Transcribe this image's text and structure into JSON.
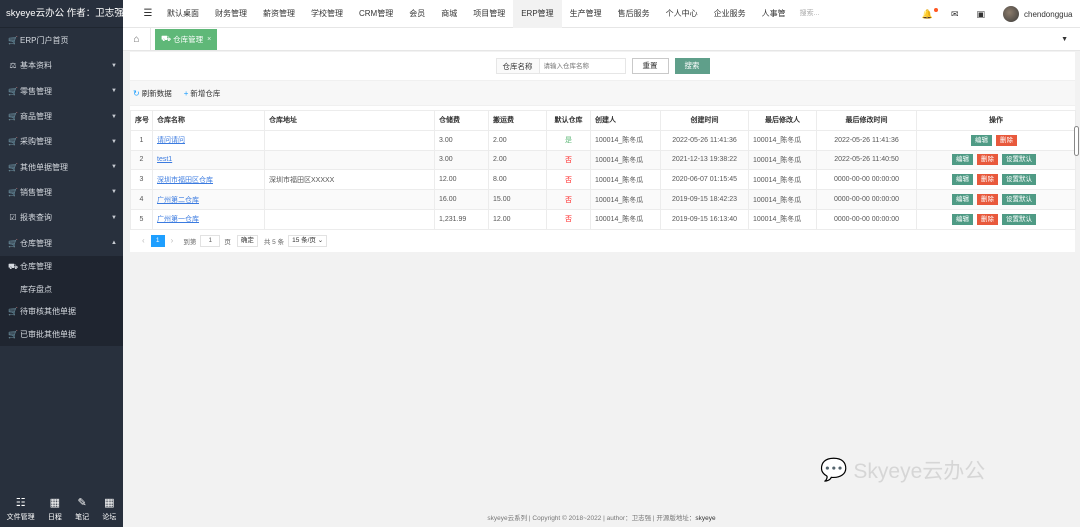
{
  "brand": "skyeye云办公 作者：卫志强",
  "sidebar": {
    "items": [
      {
        "icon": "cart-icon",
        "glyph": "🛒",
        "label": "ERP门户首页",
        "caret": ""
      },
      {
        "icon": "balance-icon",
        "glyph": "⚖",
        "label": "基本资料",
        "caret": "▼"
      },
      {
        "icon": "cart-icon",
        "glyph": "🛒",
        "label": "零售管理",
        "caret": "▼"
      },
      {
        "icon": "cart-icon",
        "glyph": "🛒",
        "label": "商品管理",
        "caret": "▼"
      },
      {
        "icon": "cart-icon",
        "glyph": "🛒",
        "label": "采购管理",
        "caret": "▼"
      },
      {
        "icon": "cart-icon",
        "glyph": "🛒",
        "label": "其他单据管理",
        "caret": "▼"
      },
      {
        "icon": "cart-icon",
        "glyph": "🛒",
        "label": "销售管理",
        "caret": "▼"
      },
      {
        "icon": "checkbox-icon",
        "glyph": "☑",
        "label": "报表查询",
        "caret": "▼"
      },
      {
        "icon": "cart-icon",
        "glyph": "🛒",
        "label": "仓库管理",
        "caret": "▲"
      }
    ],
    "subitems": [
      {
        "icon": "truck-icon",
        "glyph": "⛟",
        "label": "仓库管理"
      },
      {
        "icon": "cart-icon",
        "glyph": "",
        "label": "库存盘点"
      },
      {
        "icon": "cart-icon",
        "glyph": "🛒",
        "label": "待审核其他单据"
      },
      {
        "icon": "cart-icon",
        "glyph": "🛒",
        "label": "已审批其他单据"
      }
    ],
    "footer": [
      {
        "icon": "list-icon",
        "glyph": "☷",
        "label": "文件管理"
      },
      {
        "icon": "calendar-icon",
        "glyph": "▦",
        "label": "日程"
      },
      {
        "icon": "edit-icon",
        "glyph": "✎",
        "label": "笔记"
      },
      {
        "icon": "forum-icon",
        "glyph": "▦",
        "label": "论坛"
      }
    ]
  },
  "topnav": {
    "menu_glyph": "☰",
    "items": [
      "默认桌面",
      "财务管理",
      "薪资管理",
      "学校管理",
      "CRM管理",
      "会员",
      "商城",
      "项目管理",
      "ERP管理",
      "生产管理",
      "售后服务",
      "个人中心",
      "企业服务",
      "人事管"
    ],
    "active_index": 8,
    "search_placeholder": "搜索...",
    "username": "chendonggua"
  },
  "tabs": {
    "home_glyph": "⌂",
    "active_label": "仓库管理",
    "close_glyph": "×",
    "more_glyph": "▼"
  },
  "search": {
    "label": "仓库名称",
    "placeholder": "请输入仓库名称",
    "reset_label": "重置",
    "search_label": "搜索"
  },
  "toolbar": {
    "refresh_label": "刷新数据",
    "add_label": "新增仓库"
  },
  "table": {
    "headers": [
      "序号",
      "仓库名称",
      "仓库地址",
      "仓储费",
      "搬运费",
      "默认仓库",
      "创建人",
      "创建时间",
      "最后修改人",
      "最后修改时间",
      "操作"
    ],
    "rows": [
      {
        "no": "1",
        "name": "请问请问",
        "address": "",
        "storage_fee": "3.00",
        "handling_fee": "2.00",
        "default": "是",
        "is_default": true,
        "creator": "100014_陈冬瓜",
        "created": "2022-05-26 11:41:36",
        "modifier": "100014_陈冬瓜",
        "modified": "2022-05-26 11:41:36"
      },
      {
        "no": "2",
        "name": "test1",
        "address": "",
        "storage_fee": "3.00",
        "handling_fee": "2.00",
        "default": "否",
        "is_default": false,
        "creator": "100014_陈冬瓜",
        "created": "2021-12-13 19:38:22",
        "modifier": "100014_陈冬瓜",
        "modified": "2022-05-26 11:40:50"
      },
      {
        "no": "3",
        "name": "深圳市福田区仓库",
        "address": "深圳市福田区XXXXX",
        "storage_fee": "12.00",
        "handling_fee": "8.00",
        "default": "否",
        "is_default": false,
        "creator": "100014_陈冬瓜",
        "created": "2020-06-07 01:15:45",
        "modifier": "100014_陈冬瓜",
        "modified": "0000-00-00 00:00:00"
      },
      {
        "no": "4",
        "name": "广州第二仓库",
        "address": "",
        "storage_fee": "16.00",
        "handling_fee": "15.00",
        "default": "否",
        "is_default": false,
        "creator": "100014_陈冬瓜",
        "created": "2019-09-15 18:42:23",
        "modifier": "100014_陈冬瓜",
        "modified": "0000-00-00 00:00:00"
      },
      {
        "no": "5",
        "name": "广州第一仓库",
        "address": "",
        "storage_fee": "1,231.99",
        "handling_fee": "12.00",
        "default": "否",
        "is_default": false,
        "creator": "100014_陈冬瓜",
        "created": "2019-09-15 16:13:40",
        "modifier": "100014_陈冬瓜",
        "modified": "0000-00-00 00:00:00"
      }
    ],
    "action_edit": "编辑",
    "action_delete": "删除",
    "action_set_default": "设置默认"
  },
  "pager": {
    "prev_glyph": "‹",
    "current": "1",
    "next_glyph": "›",
    "goto_label": "到第",
    "goto_value": "1",
    "page_unit": "页",
    "ok_label": "确定",
    "total_label": "共 5 条",
    "page_size": "15 条/页 ⌄"
  },
  "watermark": "Skyeye云办公",
  "footer": {
    "text": "skyeye云系列 | Copyright © 2018~2022 | author：卫志强 | 开源版地址：",
    "link": "skyeye"
  },
  "colors": {
    "sidebar_bg": "#28303d",
    "accent_green": "#5fb878",
    "button_teal": "#5f9f8a",
    "delete_red": "#e8593c",
    "link_blue": "#3b7be0",
    "pager_blue": "#1e9fff"
  }
}
